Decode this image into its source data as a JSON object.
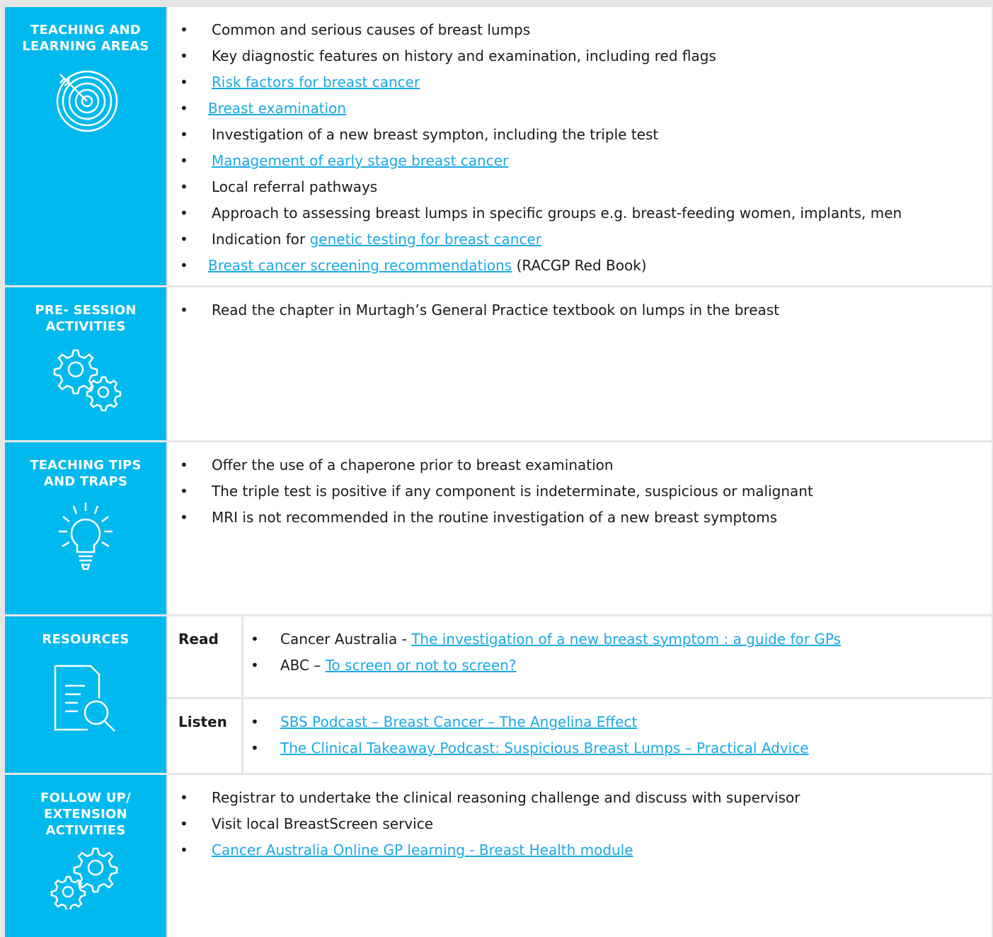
{
  "sections": {
    "teaching": {
      "title": "TEACHING AND LEARNING AREAS",
      "icon": "target-icon",
      "items": [
        {
          "text": "Common and serious causes of breast lumps"
        },
        {
          "text": "Key diagnostic features on history and examination, including red flags"
        },
        {
          "link": "Risk factors for breast cancer"
        },
        {
          "link": "Breast examination"
        },
        {
          "text": "Investigation of a new breast sympton, including the triple test"
        },
        {
          "link": "Management of early stage breast cancer"
        },
        {
          "text": "Local referral pathways"
        },
        {
          "text": "Approach to assessing breast lumps in specific groups e.g. breast-feeding women, implants, men"
        },
        {
          "pre": "Indication for ",
          "link": "genetic testing for breast cancer"
        },
        {
          "link": "Breast cancer screening recommendations",
          "post": " (RACGP Red Book)"
        }
      ]
    },
    "pre_session": {
      "title": "PRE- SESSION ACTIVITIES",
      "icon": "gears-icon",
      "items": [
        {
          "text": "Read the chapter in Murtagh’s General Practice textbook on lumps in the breast"
        }
      ]
    },
    "tips": {
      "title": "TEACHING TIPS AND TRAPS",
      "icon": "lightbulb-icon",
      "items": [
        {
          "text": "Offer the use of a chaperone prior to breast examination"
        },
        {
          "text": "The triple test is positive if any component is indeterminate, suspicious or malignant"
        },
        {
          "text": "MRI is not recommended in the routine investigation of a new breast symptoms"
        }
      ]
    },
    "resources": {
      "title": "RESOURCES",
      "icon": "document-search-icon",
      "read": {
        "label": "Read",
        "items": [
          {
            "pre": "Cancer Australia - ",
            "link": "The investigation of a new breast symptom : a guide for GPs "
          },
          {
            "pre": "ABC – ",
            "link": "To screen or not to screen?"
          }
        ]
      },
      "listen": {
        "label": "Listen",
        "items": [
          {
            "link": "SBS Podcast – Breast Cancer – The Angelina Effect"
          },
          {
            "link": "The Clinical Takeaway Podcast: Suspicious Breast Lumps – Practical Advice"
          }
        ]
      }
    },
    "follow_up": {
      "title": "FOLLOW UP/ EXTENSION ACTIVITIES",
      "icon": "gears-icon",
      "items": [
        {
          "text": "Registrar to undertake the clinical reasoning challenge and discuss with supervisor"
        },
        {
          "text": "Visit local BreastScreen service"
        },
        {
          "link": "Cancer Australia Online GP learning - Breast Health module"
        }
      ]
    }
  },
  "bullet_char": "•",
  "colors": {
    "accent": "#00b9ee",
    "link": "#1aa9e4",
    "background": "#e6e6e6"
  }
}
